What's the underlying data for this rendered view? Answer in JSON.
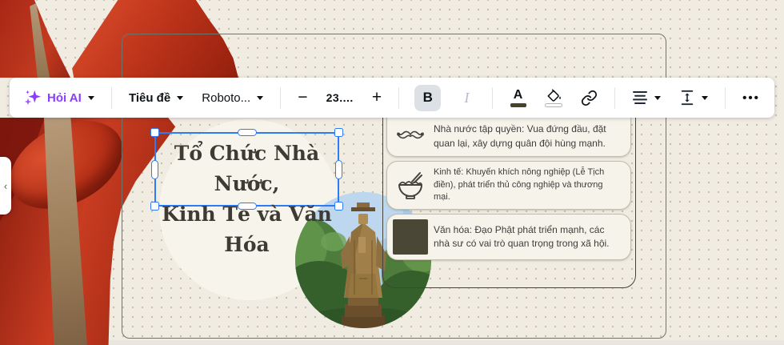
{
  "editor": {
    "collapse_chevron": "‹"
  },
  "toolbar": {
    "ask_ai_label": "Hỏi AI",
    "text_style_label": "Tiêu đề",
    "font_name": "Roboto...",
    "font_size": "23....",
    "bold_label": "B",
    "italic_label": "I",
    "text_color_label": "A",
    "more_label": "•••"
  },
  "slide": {
    "title_line1": "Tổ Chức Nhà Nước,",
    "title_line2": "Kinh Tế và Văn Hóa",
    "cards": [
      {
        "icon": "mustache-icon",
        "text": "Nhà nước tập quyền: Vua đứng đầu, đặt quan lại, xây dựng quân đội hùng mạnh."
      },
      {
        "icon": "rice-bowl-icon",
        "text": "Kinh tế: Khuyến khích nông nghiệp (Lễ Tịch điền), phát triển thủ công nghiệp và thương mại."
      },
      {
        "icon": "dark-square-swatch",
        "text": "Văn hóa: Đạo Phật phát triển mạnh, các nhà sư có vai trò quan trọng trong xã hội."
      }
    ]
  },
  "colors": {
    "accent_purple": "#8b3dff",
    "selection_blue": "#2f7bf5",
    "ribbon_red": "#c23a20",
    "toolbar_text": "#0d1216",
    "text_color_swatch": "#474128",
    "culture_swatch": "#4b4737"
  }
}
